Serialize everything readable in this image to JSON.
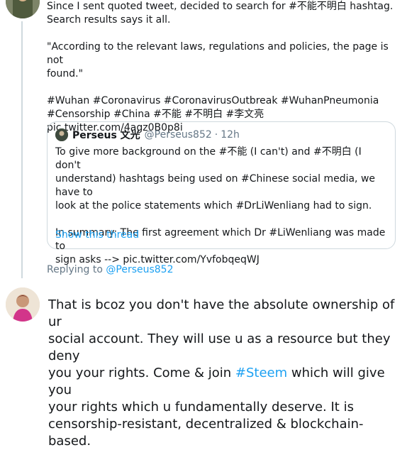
{
  "tweet": {
    "lines": [
      "Since I sent quoted tweet, decided to search for #不能不明白 hashtag.",
      "Search results says it all.",
      "",
      "\"According to the relevant laws, regulations and policies, the page is not",
      "found.\"",
      "",
      "#Wuhan #Coronavirus #CoronavirusOutbreak #WuhanPneumonia",
      "#Censorship #China #不能 #不明白 #李文亮  pic.twitter.com/4agz0B0p8i"
    ]
  },
  "quote": {
    "name": "Perseus 文光",
    "handle": "@Perseus852",
    "separator": "·",
    "time": "12h",
    "paragraph1": [
      "To give more background on the #不能 (I can't) and #不明白 (I don't",
      "understand) hashtags being used on #Chinese social media, we have to",
      "look at the police statements which #DrLiWenliang had to sign."
    ],
    "paragraph2": [
      "In summary: The first agreement which Dr #LiWenliang was made to",
      "sign asks --> pic.twitter.com/YvfobqeqWJ"
    ],
    "show_thread": "Show this thread"
  },
  "replying_to": {
    "prefix": "Replying to ",
    "handle": "@Perseus852"
  },
  "reply": {
    "line1": "That is bcoz you don't have the absolute ownership of ur",
    "line2": "social account. They will use u as a resource but they deny",
    "line3": "you your rights. Come & join ",
    "hashtag": "#Steem",
    "line3b": " which will give you",
    "line4": "your rights which u fundamentally deserve. It is",
    "line5": "censorship-resistant, decentralized & blockchain-based."
  }
}
